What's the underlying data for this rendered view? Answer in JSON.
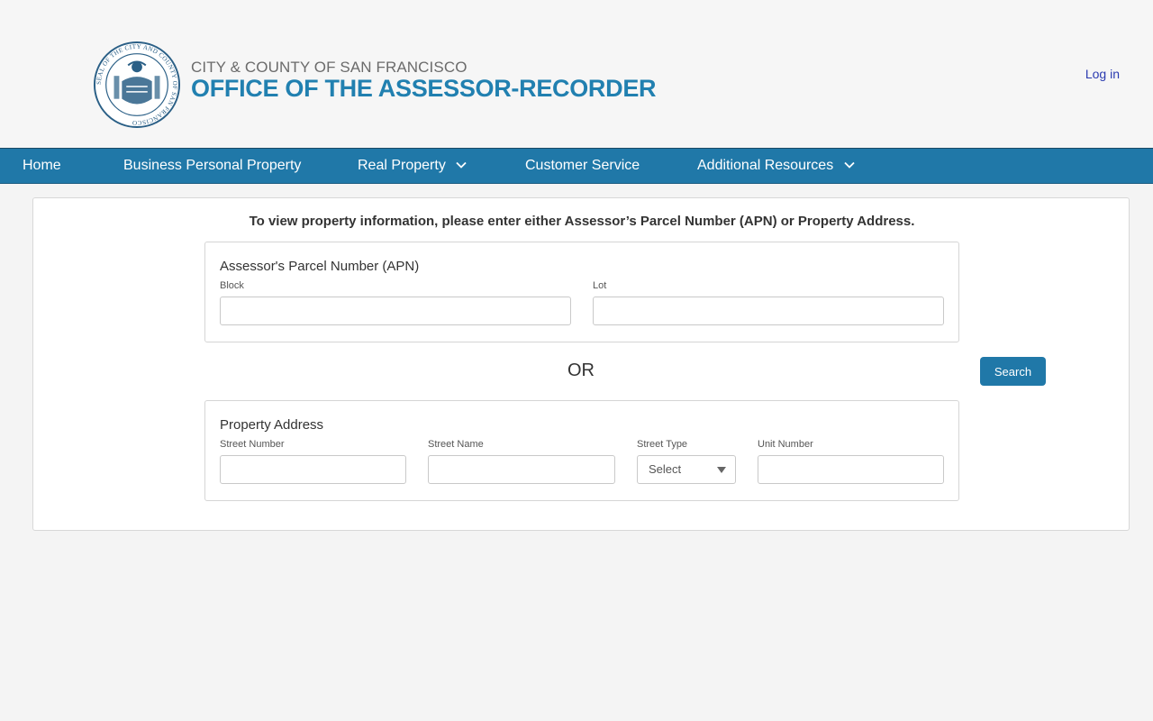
{
  "header": {
    "brand_top": "CITY & COUNTY OF SAN FRANCISCO",
    "brand_main": "OFFICE OF THE ASSESSOR-RECORDER",
    "seal_text": "SEAL OF THE CITY AND COUNTY OF SAN FRANCISCO",
    "login_label": "Log in"
  },
  "nav": {
    "items": [
      {
        "label": "Home",
        "has_dropdown": false
      },
      {
        "label": "Business Personal Property",
        "has_dropdown": false
      },
      {
        "label": "Real Property",
        "has_dropdown": true
      },
      {
        "label": "Customer Service",
        "has_dropdown": false
      },
      {
        "label": "Additional Resources",
        "has_dropdown": true
      }
    ]
  },
  "search": {
    "instructions": "To view property information, please enter either Assessor’s Parcel Number (APN) or Property Address.",
    "apn": {
      "title": "Assessor's Parcel Number (APN)",
      "block_label": "Block",
      "block_value": "",
      "lot_label": "Lot",
      "lot_value": ""
    },
    "or_label": "OR",
    "search_label": "Search",
    "address": {
      "title": "Property Address",
      "street_number_label": "Street Number",
      "street_number_value": "",
      "street_name_label": "Street Name",
      "street_name_value": "",
      "street_type_label": "Street Type",
      "street_type_selected": "Select",
      "unit_number_label": "Unit Number",
      "unit_number_value": ""
    }
  },
  "colors": {
    "brand_blue": "#2180b0",
    "nav_blue": "#2078a8",
    "link_blue": "#2b3bb0",
    "seal_blue": "#2a5f86"
  },
  "icons": {
    "seal": "city-seal-icon",
    "dropdown": "chevron-down-icon",
    "select_caret": "caret-down-icon"
  }
}
